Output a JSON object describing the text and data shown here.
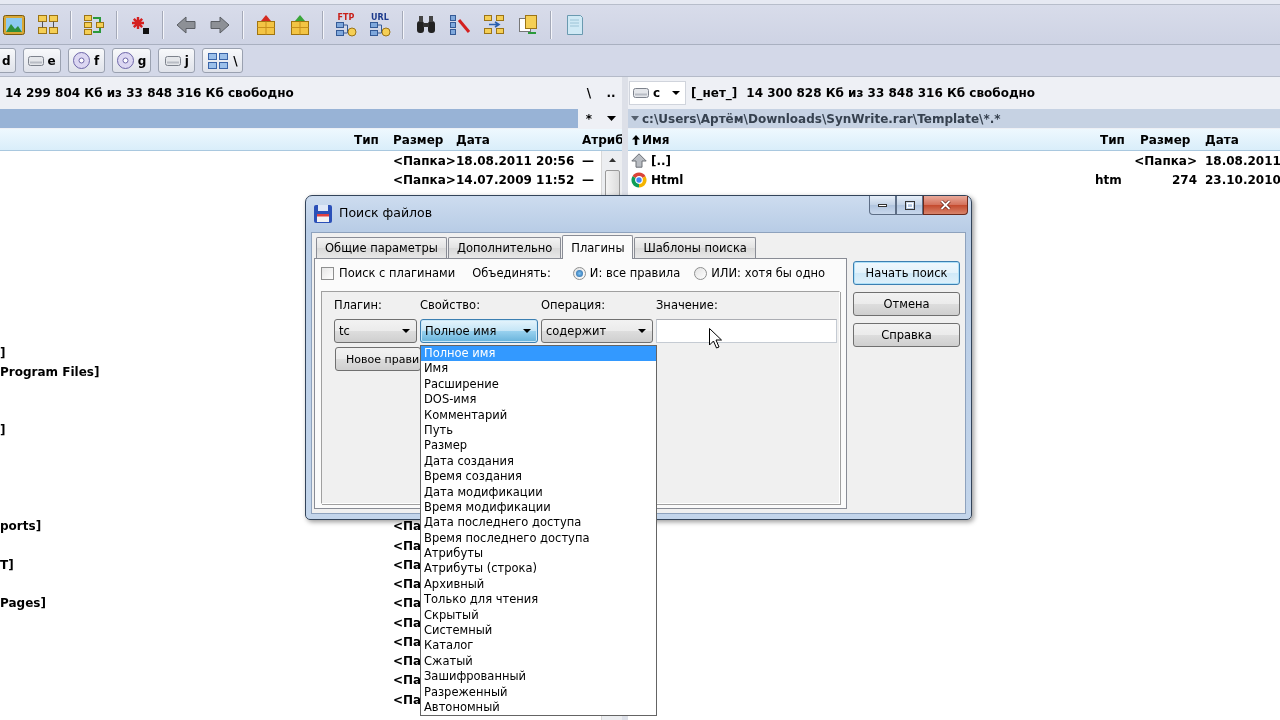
{
  "toolbar": {
    "icon_captions": [
      "FTP",
      "URL"
    ]
  },
  "drives": [
    {
      "letter": "d",
      "kind": "hdd"
    },
    {
      "letter": "e",
      "kind": "hdd"
    },
    {
      "letter": "f",
      "kind": "cd"
    },
    {
      "letter": "g",
      "kind": "cd"
    },
    {
      "letter": "j",
      "kind": "hdd"
    },
    {
      "letter": "\\",
      "kind": "network"
    }
  ],
  "left_panel": {
    "active": true,
    "free_space": "14 299 804 Кб из 33 848 316 Кб свободно",
    "nav_buttons": [
      "\\",
      ".."
    ],
    "filter_button": "*",
    "columns": [
      {
        "label": "Тип",
        "sorted": false
      },
      {
        "label": "Размер",
        "sorted": false
      },
      {
        "label": "Дата",
        "sorted": false
      },
      {
        "label": "Атриб",
        "sorted": false
      }
    ],
    "rows": [
      {
        "size": "<Папка>",
        "date": "18.08.2011 20:56",
        "attributes": "—"
      },
      {
        "size": "<Папка>",
        "date": "14.07.2009 11:52",
        "attributes": "—"
      },
      {},
      {},
      {},
      {},
      {},
      {},
      {},
      {},
      {
        "name": "]"
      },
      {
        "name": "Program Files]"
      },
      {},
      {},
      {
        "name": "]"
      },
      {},
      {},
      {},
      {},
      {
        "name": "ports]",
        "size": "<Па"
      },
      {
        "size": "<Па"
      },
      {
        "name": "T]",
        "size": "<Па"
      },
      {
        "size": "<Па"
      },
      {
        "name": "Pages]",
        "size": "<Па"
      },
      {
        "size": "<Па"
      },
      {
        "size": "<Па"
      },
      {
        "size": "<Па"
      },
      {
        "size": "<Па"
      },
      {
        "size": "<Па"
      }
    ]
  },
  "right_panel": {
    "active": false,
    "drive": "c",
    "volume_label": "[_нет_]",
    "free_space": "14 300 828 Кб из 33 848 316 Кб свободно",
    "path": "c:\\Users\\Артём\\Downloads\\SynWrite.rar\\Template\\*.*",
    "columns": [
      {
        "label": "Имя",
        "sorted": true
      },
      {
        "label": "Тип",
        "sorted": false
      },
      {
        "label": "Размер",
        "sorted": false
      },
      {
        "label": "Дата",
        "sorted": false
      }
    ],
    "rows": [
      {
        "kind": "parent",
        "name": "[..]",
        "size": "<Папка>",
        "date": "18.08.2011"
      },
      {
        "kind": "file",
        "name": "Html",
        "type": "htm",
        "size": "274",
        "date": "23.10.2010"
      }
    ]
  },
  "search_dialog": {
    "title": "Поиск файлов",
    "tabs": [
      {
        "label": "Общие параметры",
        "selected": false
      },
      {
        "label": "Дополнительно",
        "selected": false
      },
      {
        "label": "Плагины",
        "selected": true
      },
      {
        "label": "Шаблоны поиска",
        "selected": false
      }
    ],
    "plugin_search": {
      "label": "Поиск с плагинами",
      "checked": false
    },
    "combine_label": "Объединять:",
    "combine_options": [
      {
        "label": "И: все правила",
        "selected": true
      },
      {
        "label": "ИЛИ: хотя бы одно",
        "selected": false
      }
    ],
    "rule_fields": [
      {
        "kind": "combo",
        "label": "Плагин:",
        "value": "tc",
        "focused": false,
        "expanded": false
      },
      {
        "kind": "combo",
        "label": "Свойство:",
        "value": "Полное имя",
        "focused": true,
        "expanded": true,
        "options": [
          {
            "label": "Полное имя",
            "selected": true
          },
          {
            "label": "Имя",
            "selected": false
          },
          {
            "label": "Расширение",
            "selected": false
          },
          {
            "label": "DOS-имя",
            "selected": false
          },
          {
            "label": "Комментарий",
            "selected": false
          },
          {
            "label": "Путь",
            "selected": false
          },
          {
            "label": "Размер",
            "selected": false
          },
          {
            "label": "Дата создания",
            "selected": false
          },
          {
            "label": "Время создания",
            "selected": false
          },
          {
            "label": "Дата модификации",
            "selected": false
          },
          {
            "label": "Время модификации",
            "selected": false
          },
          {
            "label": "Дата последнего доступа",
            "selected": false
          },
          {
            "label": "Время последнего доступа",
            "selected": false
          },
          {
            "label": "Атрибуты",
            "selected": false
          },
          {
            "label": "Атрибуты (строка)",
            "selected": false
          },
          {
            "label": "Архивный",
            "selected": false
          },
          {
            "label": "Только для чтения",
            "selected": false
          },
          {
            "label": "Скрытый",
            "selected": false
          },
          {
            "label": "Системный",
            "selected": false
          },
          {
            "label": "Каталог",
            "selected": false
          },
          {
            "label": "Сжатый",
            "selected": false
          },
          {
            "label": "Зашифрованный",
            "selected": false
          },
          {
            "label": "Разреженный",
            "selected": false
          },
          {
            "label": "Автономный",
            "selected": false
          }
        ]
      },
      {
        "kind": "combo",
        "label": "Операция:",
        "value": "содержит",
        "focused": false,
        "expanded": false
      },
      {
        "kind": "text",
        "label": "Значение:"
      }
    ],
    "new_rule_button": "Новое прави",
    "buttons": [
      {
        "label": "Начать поиск",
        "default": true
      },
      {
        "label": "Отмена",
        "default": false
      },
      {
        "label": "Справка",
        "default": false
      }
    ]
  }
}
